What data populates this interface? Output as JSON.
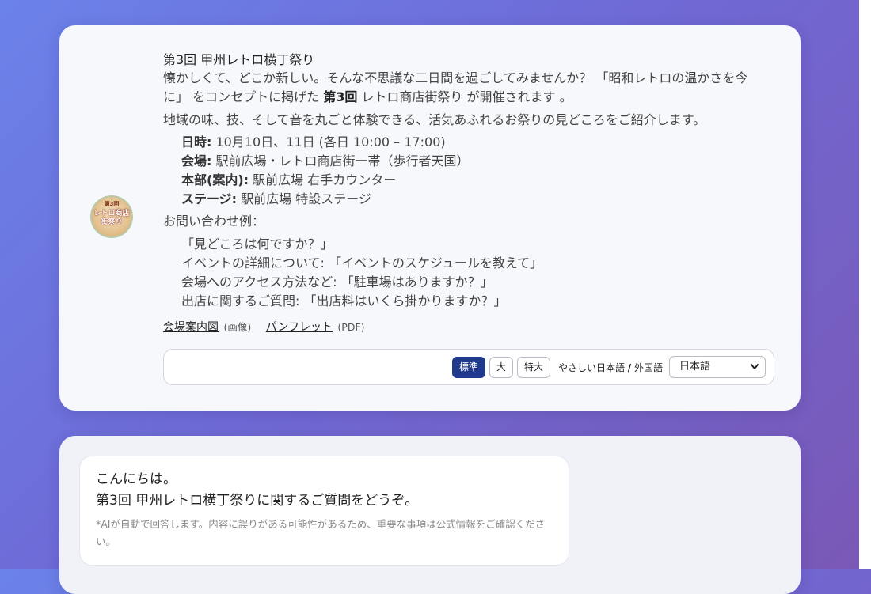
{
  "info_card": {
    "logo": {
      "line1": "第3回",
      "line2": "レトロ商店街祭り"
    },
    "title": "第3回 甲州レトロ横丁祭り",
    "intro": {
      "part1": "懐かしくて、どこか新しい。そんな不思議な二日間を過ごしてみませんか？ 「昭和レトロの温かさを今に」 をコンセプトに掲げた ",
      "bold": "第3回",
      "part2": " レトロ商店街祭り が開催されます 。"
    },
    "intro2": "地域の味、技、そして音を丸ごと体験できる、活気あふれるお祭りの見どころをご紹介します。",
    "details": [
      {
        "label": "日時:",
        "value": " 10月10日、11日 (各日 10:00 – 17:00)"
      },
      {
        "label": "会場:",
        "value": " 駅前広場・レトロ商店街一帯（歩行者天国）"
      },
      {
        "label": "本部(案内):",
        "value": " 駅前広場 右手カウンター"
      },
      {
        "label": "ステージ:",
        "value": " 駅前広場 特設ステージ"
      }
    ],
    "examples_title": "お問い合わせ例：",
    "examples": [
      "「見どころは何ですか？」",
      "イベントの詳細について: 「イベントのスケジュールを教えて」",
      "会場へのアクセス方法など: 「駐車場はありますか？」",
      "出店に関するご質問: 「出店料はいくら掛かりますか？」"
    ],
    "links": [
      {
        "label": "会場案内図",
        "note": "(画像)"
      },
      {
        "label": "パンフレット",
        "note": "(PDF)"
      }
    ]
  },
  "toolbar": {
    "sizes": [
      "標準",
      "大",
      "特大"
    ],
    "active_size": "標準",
    "lang_label_a": "やさしい日本語 ",
    "lang_label_sep": "/",
    "lang_label_b": " 外国語",
    "lang_selected": "日本語"
  },
  "chat": {
    "greeting_line1": "こんにちは。",
    "greeting_line2": "第3回 甲州レトロ横丁祭りに関するご質問をどうぞ。",
    "disclaimer": "*AIが自動で回答します。内容に誤りがある可能性があるため、重要な事項は公式情報をご確認ください。"
  },
  "colors": {
    "bg_start": "#6b82ea",
    "bg_end": "#7a58b6",
    "active_button": "#1f3a8a"
  },
  "icons": [
    "festival-logo-icon",
    "chevron-down-icon"
  ]
}
